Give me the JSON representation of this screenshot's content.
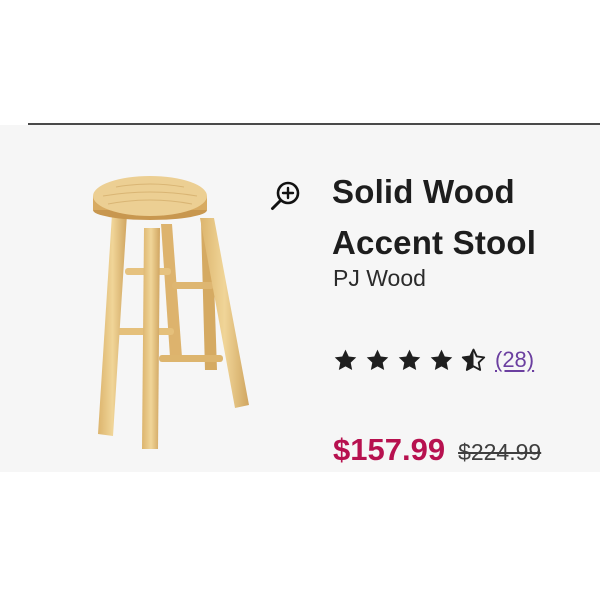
{
  "product": {
    "title_line1": "Solid Wood",
    "title_line2": "Accent Stool",
    "brand": "PJ Wood",
    "rating": 4.5,
    "review_count": "(28)",
    "sale_price": "$157.99",
    "original_price": "$224.99",
    "image_subject": "wooden-bar-stool",
    "image_count": 4,
    "active_image": 0
  },
  "icons": {
    "zoom": "zoom-in-icon",
    "star": "star-icon",
    "half_star": "half-star-icon"
  },
  "colors": {
    "sale_price": "#b7114f",
    "review_link": "#6b3fa0",
    "star": "#1f1f1f"
  }
}
